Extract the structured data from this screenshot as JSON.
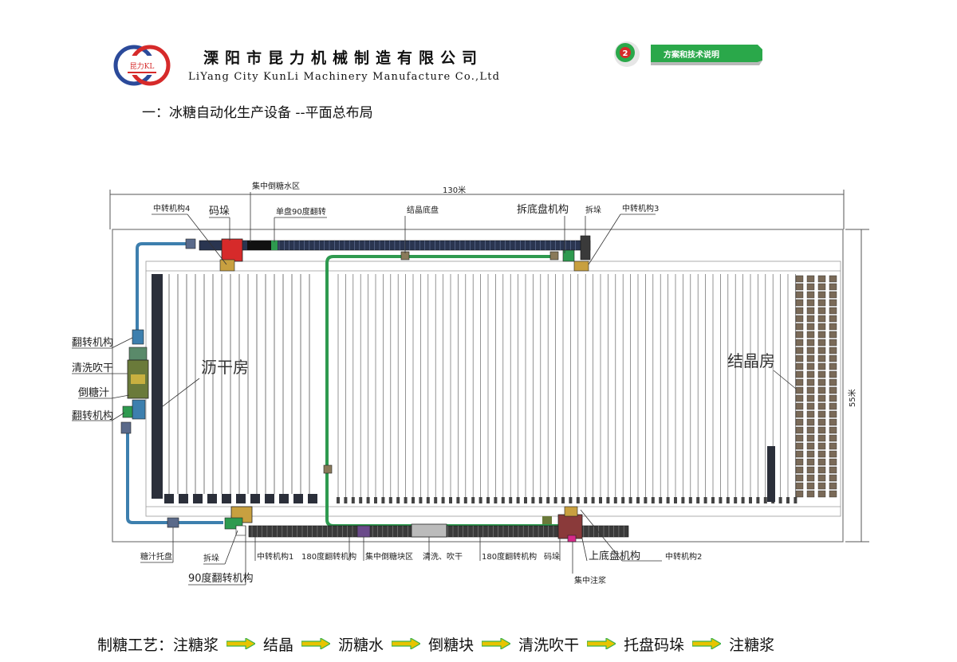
{
  "header": {
    "logo_text": "昆力KL",
    "company_cn": "溧阳市昆力机械制造有限公司",
    "company_en": "LiYang  City KunLi Machinery Manufacture Co.,Ltd",
    "section_number": "2",
    "section_label": "方案和技术说明"
  },
  "heading": "一：冰糖自动化生产设备 --平面总布局",
  "dimensions": {
    "length": "130米",
    "width": "55米"
  },
  "rooms": {
    "drain_room": "沥干房",
    "crystal_room": "结晶房"
  },
  "labels": {
    "top": {
      "transfer4": "中转机构4",
      "stack_top": "码垛",
      "pour_water_zone": "集中倒糖水区",
      "single_flip90": "单盘90度翻转",
      "crystal_tray": "结晶底盘",
      "unstack_tray": "拆底盘机构",
      "unstack": "拆垛",
      "transfer3": "中转机构3"
    },
    "left": {
      "flip_top": "翻转机构",
      "wash_dry": "清洗吹干",
      "pour_juice": "倒糖汁",
      "flip_bottom": "翻转机构"
    },
    "bottom": {
      "juice_tray": "糖汁托盘",
      "unstack": "拆垛",
      "flip90": "90度翻转机构",
      "transfer1": "中转机构1",
      "flip180_a": "180度翻转机构",
      "pour_block_zone": "集中倒糖块区",
      "wash_blow": "清洗、吹干",
      "flip180_b": "180度翻转机构",
      "stack": "码垛",
      "pour_syrup": "集中注浆",
      "load_tray": "上底盘机构",
      "transfer2": "中转机构2"
    }
  },
  "process": {
    "title": "制糖工艺：",
    "steps": [
      "注糖浆",
      "结晶",
      "沥糖水",
      "倒糖块",
      "清洗吹干",
      "托盘码垛",
      "注糖浆"
    ]
  },
  "colors": {
    "blue_line": "#3d7fae",
    "green_line": "#2e9a4f",
    "conveyor": "#2a3550",
    "logo_red": "#d62a2a",
    "logo_blue": "#2b4a9a",
    "badge_green": "#2aa84a",
    "arrow_yellow": "#e8c400",
    "arrow_green": "#3bb34a"
  }
}
